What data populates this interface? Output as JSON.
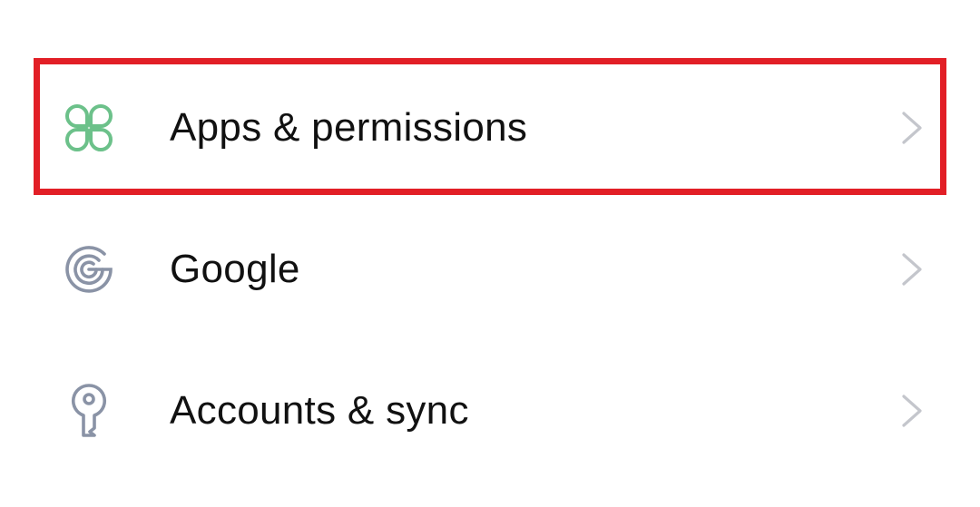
{
  "settings": {
    "items": [
      {
        "label": "Apps & permissions",
        "icon": "apps-grid-icon",
        "icon_color": "#6cc18a",
        "highlighted": true
      },
      {
        "label": "Google",
        "icon": "google-g-icon",
        "icon_color": "#8a93a6",
        "highlighted": false
      },
      {
        "label": "Accounts & sync",
        "icon": "key-icon",
        "icon_color": "#8a93a6",
        "highlighted": false
      }
    ]
  },
  "colors": {
    "highlight_border": "#e21f26",
    "chevron": "#c4c6cc",
    "text": "#111111",
    "background": "#ffffff"
  }
}
